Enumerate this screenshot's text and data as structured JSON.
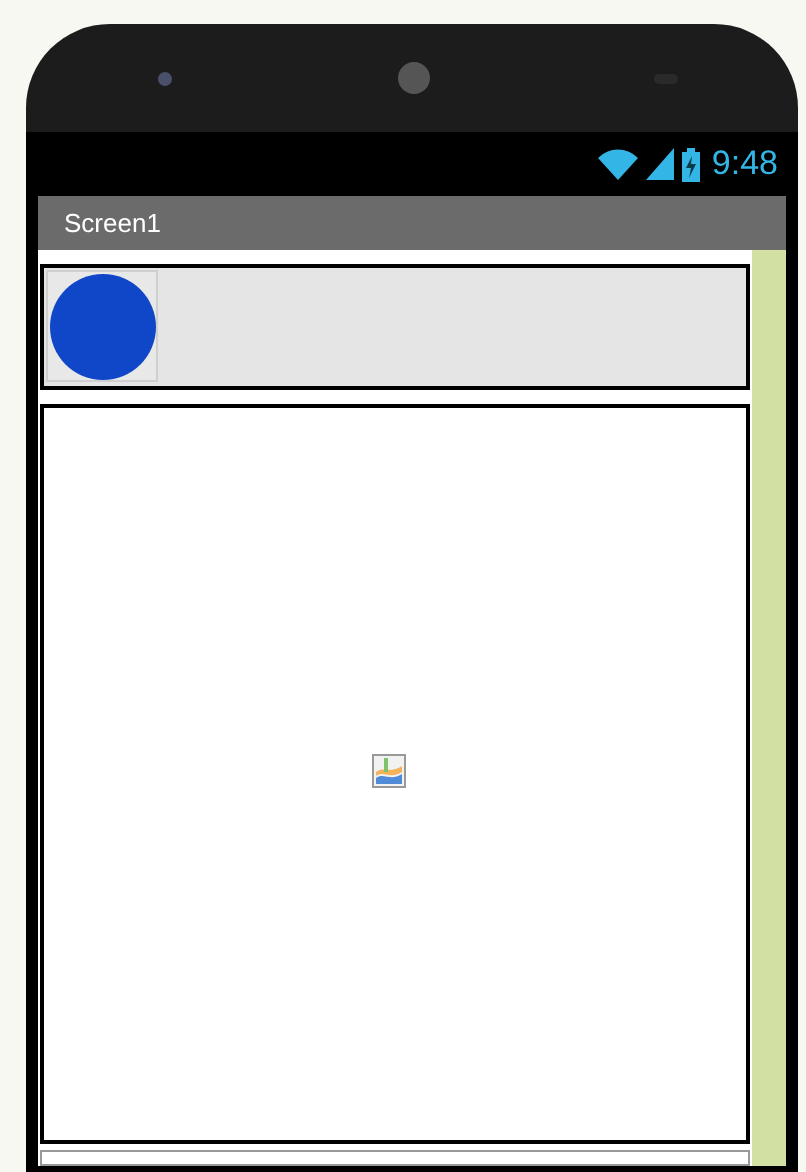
{
  "status_bar": {
    "time": "9:48"
  },
  "title_bar": {
    "title": "Screen1"
  }
}
